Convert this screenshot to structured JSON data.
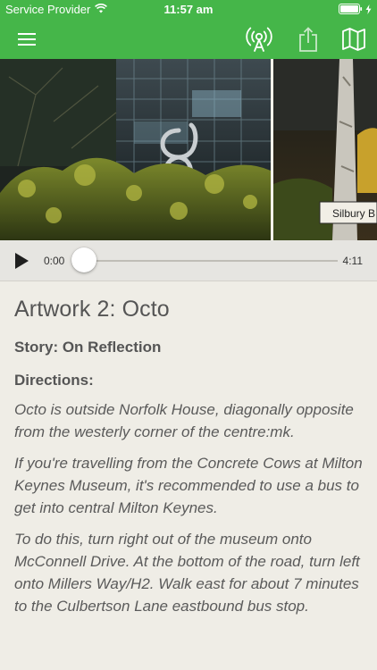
{
  "status": {
    "carrier": "Service Provider",
    "time": "11:57 am"
  },
  "navbar": {
    "menu_icon": "hamburger-menu-icon",
    "beacon_icon": "broadcast-icon",
    "share_icon": "share-icon",
    "map_icon": "map-icon"
  },
  "hero": {
    "sign_text": "Silbury B"
  },
  "player": {
    "current_time": "0:00",
    "total_time": "4:11",
    "progress": 0
  },
  "content": {
    "title": "Artwork 2: Octo",
    "story": "Story: On Reflection",
    "directions_label": "Directions:",
    "paragraphs": [
      "Octo is outside Norfolk House, diagonally opposite from the westerly corner of the centre:mk.",
      "If you're travelling from the Concrete Cows at Milton Keynes Museum, it's recommended to use a bus to get into central Milton Keynes.",
      "To do this, turn right out of the museum onto McConnell Drive. At the bottom of the road, turn left onto Millers Way/H2. Walk east for about 7 minutes to the Culbertson Lane eastbound bus stop."
    ]
  },
  "colors": {
    "accent": "#45b649",
    "background": "#efede6"
  }
}
